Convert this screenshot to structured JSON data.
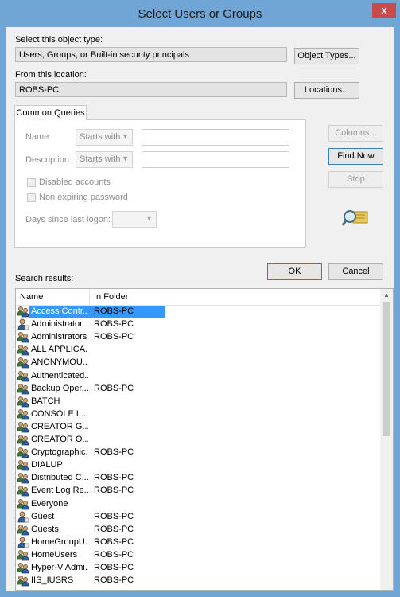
{
  "window": {
    "title": "Select Users or Groups",
    "close_glyph": "x"
  },
  "object_type": {
    "label": "Select this object type:",
    "value": "Users, Groups, or Built-in security principals",
    "button": "Object Types..."
  },
  "location": {
    "label": "From this location:",
    "value": "ROBS-PC",
    "button": "Locations..."
  },
  "queries": {
    "tab": "Common Queries",
    "name_label": "Name:",
    "description_label": "Description:",
    "starts_with": "Starts with",
    "disabled_accounts": "Disabled accounts",
    "non_expiring": "Non expiring password",
    "days_label": "Days since last logon:"
  },
  "buttons": {
    "columns": "Columns...",
    "find_now": "Find Now",
    "stop": "Stop",
    "ok": "OK",
    "cancel": "Cancel"
  },
  "results": {
    "label": "Search results:",
    "col_name": "Name",
    "col_folder": "In Folder",
    "rows": [
      {
        "name": "Access Contr...",
        "folder": "ROBS-PC",
        "icon": "group-icon"
      },
      {
        "name": "Administrator",
        "folder": "ROBS-PC",
        "icon": "user-icon"
      },
      {
        "name": "Administrators",
        "folder": "ROBS-PC",
        "icon": "group-icon"
      },
      {
        "name": "ALL APPLICA...",
        "folder": "",
        "icon": "group-icon"
      },
      {
        "name": "ANONYMOU...",
        "folder": "",
        "icon": "group-icon"
      },
      {
        "name": "Authenticated...",
        "folder": "",
        "icon": "group-icon"
      },
      {
        "name": "Backup Oper...",
        "folder": "ROBS-PC",
        "icon": "group-icon"
      },
      {
        "name": "BATCH",
        "folder": "",
        "icon": "group-icon"
      },
      {
        "name": "CONSOLE L...",
        "folder": "",
        "icon": "group-icon"
      },
      {
        "name": "CREATOR G...",
        "folder": "",
        "icon": "group-icon"
      },
      {
        "name": "CREATOR O...",
        "folder": "",
        "icon": "group-icon"
      },
      {
        "name": "Cryptographic...",
        "folder": "ROBS-PC",
        "icon": "group-icon"
      },
      {
        "name": "DIALUP",
        "folder": "",
        "icon": "group-icon"
      },
      {
        "name": "Distributed C...",
        "folder": "ROBS-PC",
        "icon": "group-icon"
      },
      {
        "name": "Event Log Re...",
        "folder": "ROBS-PC",
        "icon": "group-icon"
      },
      {
        "name": "Everyone",
        "folder": "",
        "icon": "group-icon"
      },
      {
        "name": "Guest",
        "folder": "ROBS-PC",
        "icon": "user-icon"
      },
      {
        "name": "Guests",
        "folder": "ROBS-PC",
        "icon": "group-icon"
      },
      {
        "name": "HomeGroupU...",
        "folder": "ROBS-PC",
        "icon": "user-icon"
      },
      {
        "name": "HomeUsers",
        "folder": "ROBS-PC",
        "icon": "group-icon"
      },
      {
        "name": "Hyper-V Admi...",
        "folder": "ROBS-PC",
        "icon": "group-icon"
      },
      {
        "name": "IIS_IUSRS",
        "folder": "ROBS-PC",
        "icon": "group-icon"
      }
    ]
  },
  "colors": {
    "titlebar": "#6fa6d6",
    "selection": "#3399ff",
    "close": "#c74b4b"
  }
}
